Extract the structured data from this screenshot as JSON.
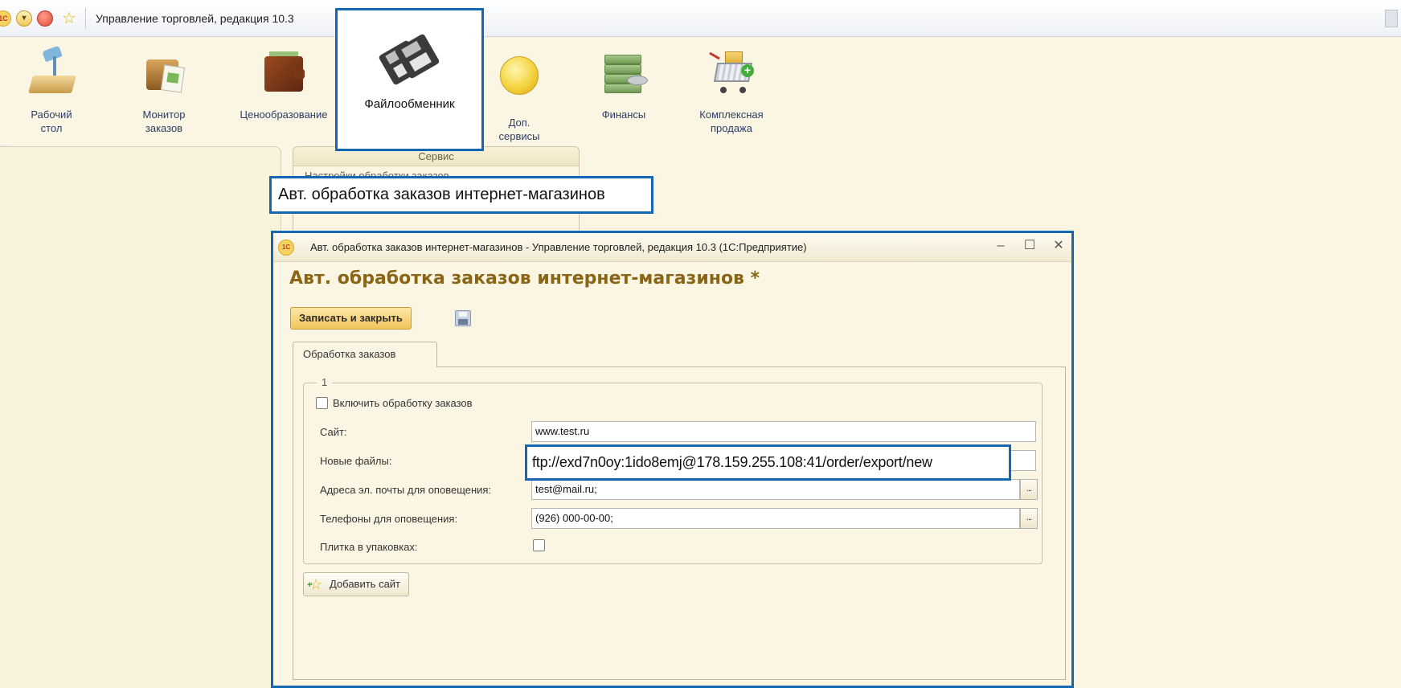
{
  "app": {
    "title": "Управление торговлей, редакция 10.3",
    "logo_text": "1С",
    "accent_color": "#1467b3"
  },
  "sections": [
    {
      "label": "Рабочий\nстол",
      "icon": "desk-lamp-icon"
    },
    {
      "label": "Монитор\nзаказов",
      "icon": "briefcase-report-icon"
    },
    {
      "label": "Ценообразование",
      "icon": "wallet-icon"
    },
    {
      "label": "Файлообменник",
      "icon": "floppy-disks-icon"
    },
    {
      "label": "Доп.\nсервисы",
      "icon": "coin-icon"
    },
    {
      "label": "Финансы",
      "icon": "money-stack-icon"
    },
    {
      "label": "Комплексная\nпродажа",
      "icon": "shopping-cart-add-icon"
    }
  ],
  "service_panel": {
    "header": "Сервис",
    "partial_item": "Настройки обработки заказов",
    "highlight_item": "Авт. обработка заказов интернет-магазинов"
  },
  "modal": {
    "window_title": "Авт. обработка заказов интернет-магазинов - Управление торговлей, редакция 10.3  (1С:Предприятие)",
    "heading": "Авт. обработка заказов интернет-магазинов *",
    "save_close_label": "Записать и закрыть",
    "tab_label": "Обработка заказов",
    "group_title": "1",
    "enable_label": "Включить обработку заказов",
    "enable_checked": false,
    "fields": {
      "site_label": "Сайт:",
      "site_value": "www.test.ru",
      "new_files_label": "Новые файлы:",
      "new_files_value": "ftp://exd7n0oy:1ido8emj@178.159.255.108:41/order/export/new",
      "emails_label": "Адреса эл. почты для оповещения:",
      "emails_value": "test@mail.ru;",
      "phones_label": "Телефоны для оповещения:",
      "phones_value": "(926) 000-00-00;",
      "tiles_label": "Плитка в упаковках:",
      "tiles_checked": false,
      "select_button": "..."
    },
    "add_site_label": "Добавить сайт"
  }
}
